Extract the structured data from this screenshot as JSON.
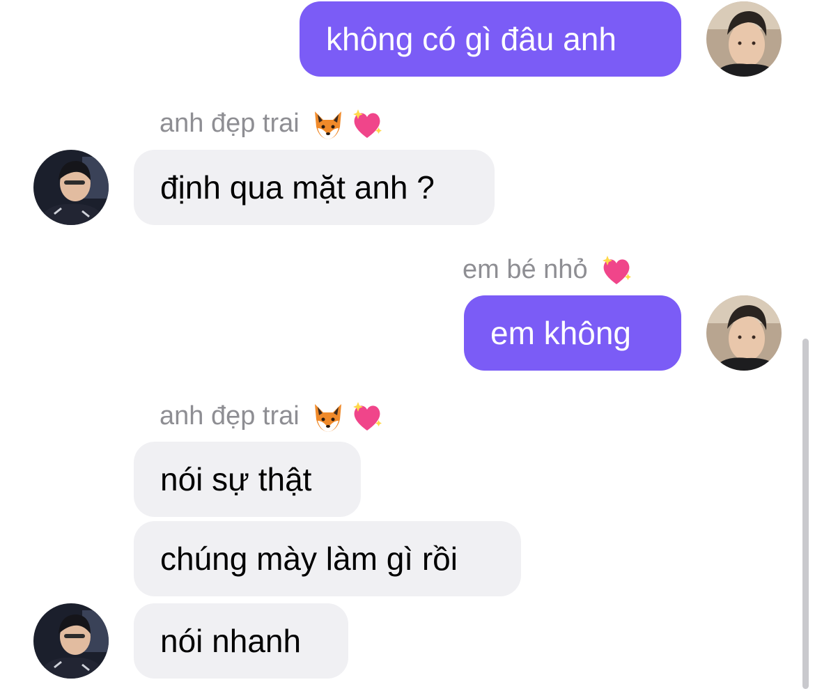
{
  "colors": {
    "outgoing_bubble": "#7b5cf6",
    "incoming_bubble": "#f0f0f3",
    "sender_name": "#8e8e93"
  },
  "messages": [
    {
      "direction": "outgoing",
      "text": "không có gì đâu anh"
    },
    {
      "direction": "incoming",
      "sender": "anh đẹp trai",
      "sender_emojis": [
        "fox-face-emoji",
        "sparkling-heart-emoji"
      ],
      "text": " định qua mặt anh ?"
    },
    {
      "direction": "outgoing",
      "sender": "em bé nhỏ",
      "sender_emojis": [
        "sparkling-heart-emoji"
      ],
      "text": "em không"
    },
    {
      "direction": "incoming",
      "sender": "anh đẹp trai",
      "sender_emojis": [
        "fox-face-emoji",
        "sparkling-heart-emoji"
      ],
      "text": "nói sự thật"
    },
    {
      "direction": "incoming",
      "text": "chúng mày làm gì rồi"
    },
    {
      "direction": "incoming",
      "text": "nói nhanh"
    }
  ]
}
